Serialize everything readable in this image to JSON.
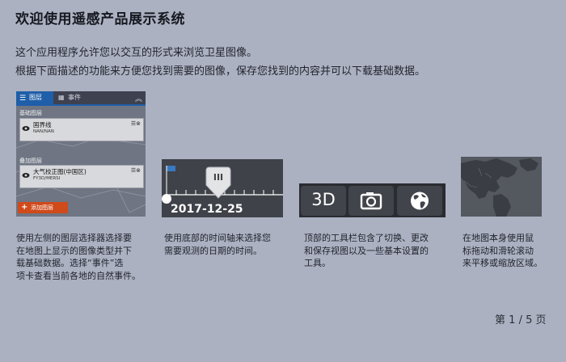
{
  "dialog": {
    "title": "欢迎使用遥感产品展示系统",
    "intro": [
      "这个应用程序允许您以交互的形式来浏览卫星图像。",
      "根据下面描述的功能来方便您找到需要的图像，保存您找到的内容并可以下载基础数据。"
    ]
  },
  "cards": {
    "layers": {
      "tab_layers": "图层",
      "tab_events": "事件",
      "section_base": "基础图层",
      "section_overlay": "叠加图层",
      "base_layer": {
        "name": "国界线",
        "sub": "NAN/NAN"
      },
      "overlay_layer": {
        "name": "大气校正图(中国区)",
        "sub": "FY3D/MERSI"
      },
      "add_button": "添加图层",
      "description": [
        "使用左侧的图层选择器选择要",
        "在地图上显示的图像类型并下",
        "载基础数据。选择“事件”选",
        "项卡查看当前各地的自然事件。"
      ]
    },
    "timeline": {
      "date": "2017-12-25",
      "handle_label": "III",
      "description": [
        "使用底部的时间轴来选择您",
        "需要观测的日期的时间。"
      ]
    },
    "toolbar": {
      "btn_3d": "3D",
      "btn_camera_icon": "camera-icon",
      "btn_globe_icon": "globe-icon",
      "description": [
        "顶部的工具栏包含了切换、更改",
        "和保存视图以及一些基本设置的",
        "工具。"
      ]
    },
    "map": {
      "description": [
        "在地图本身使用鼠",
        "标拖动和滑轮滚动",
        "来平移或缩放区域。"
      ]
    }
  },
  "pager": {
    "prefix": "第",
    "current": "1",
    "sep": "/",
    "total": "5",
    "suffix": "页"
  }
}
